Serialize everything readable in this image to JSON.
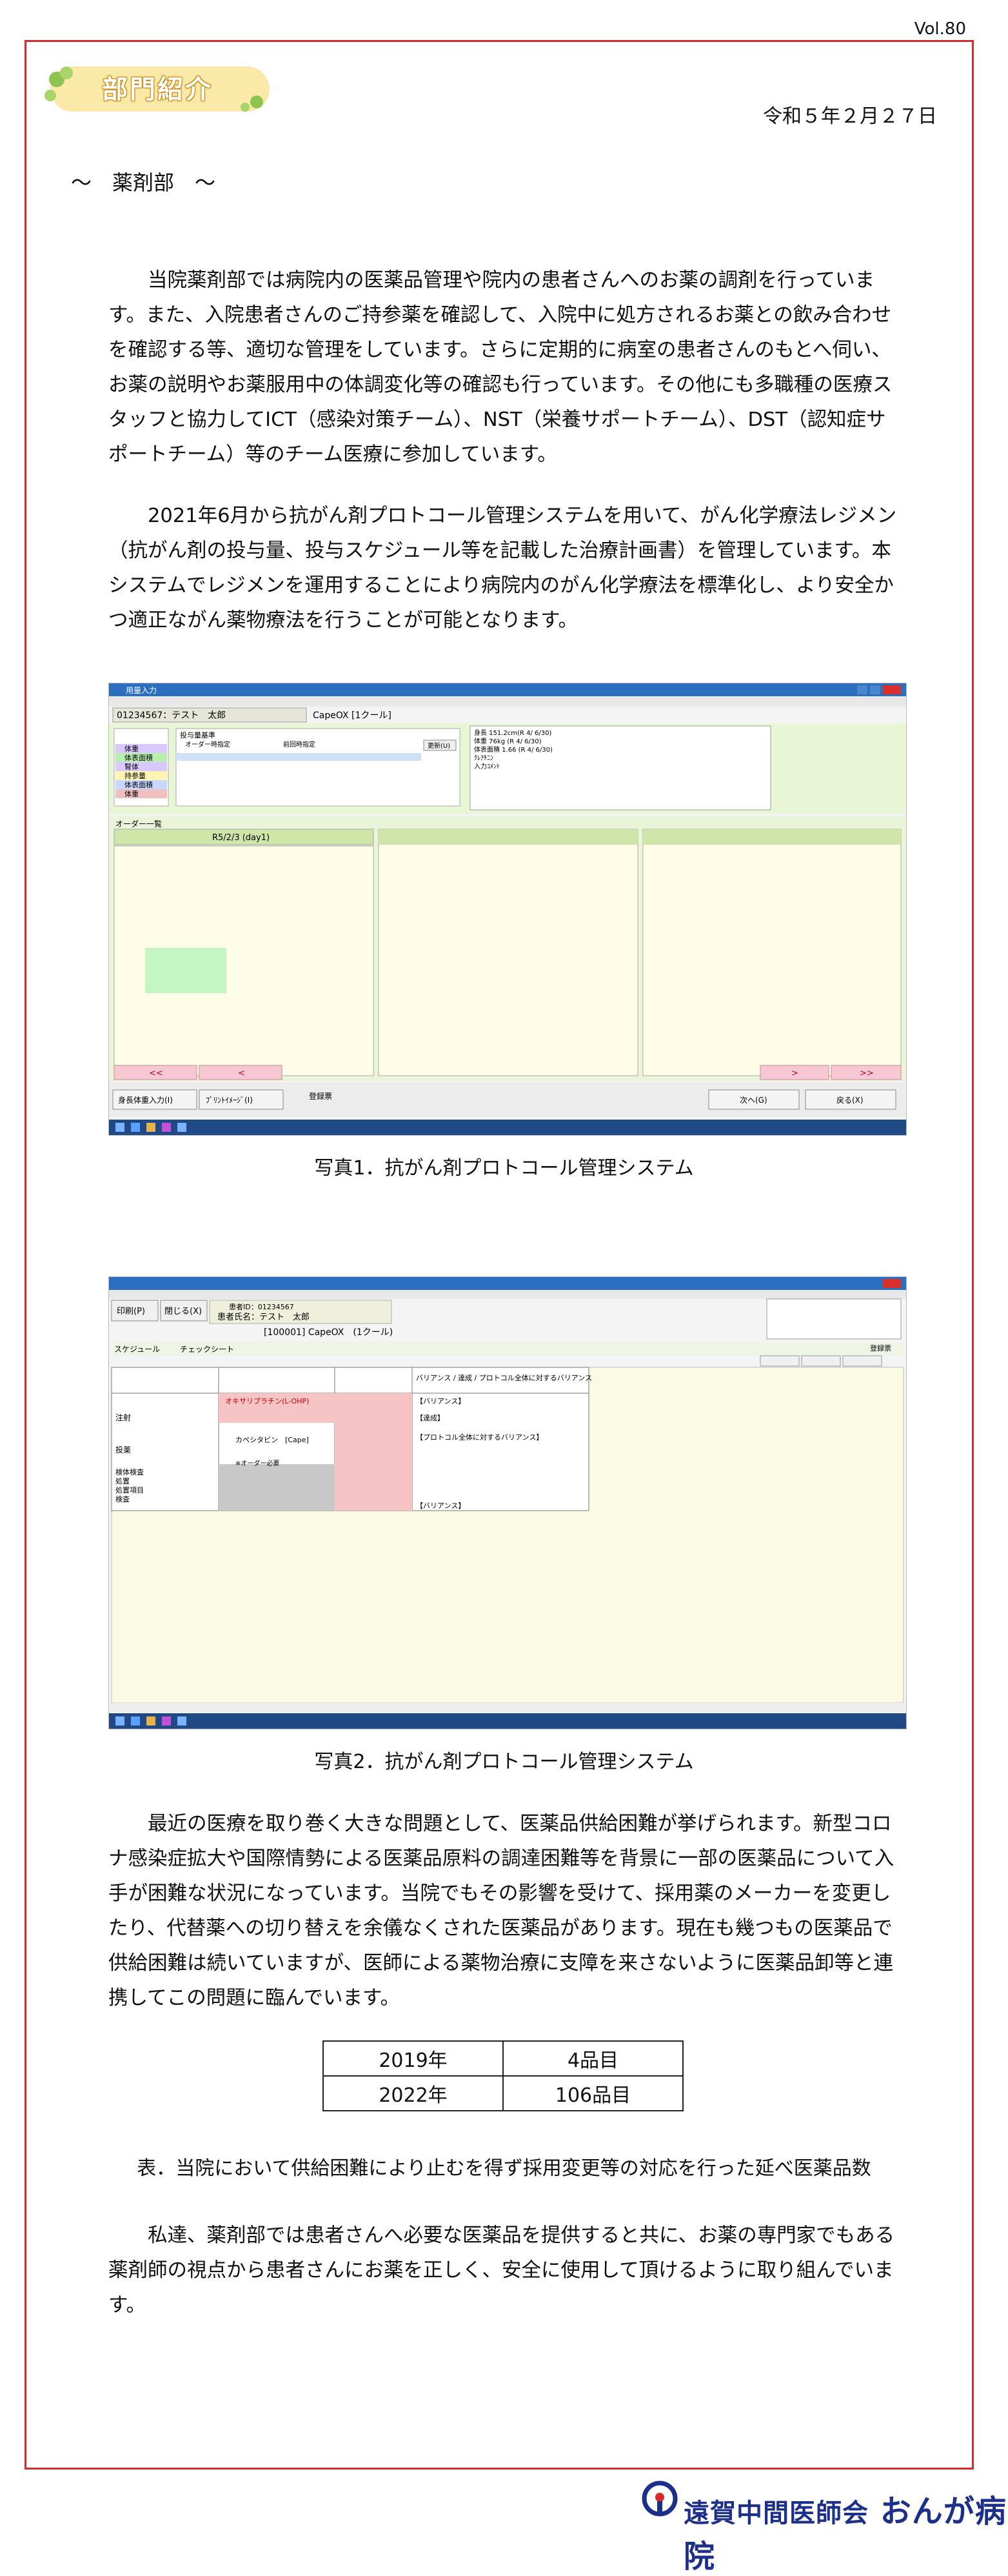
{
  "header": {
    "volume": "Vol.80",
    "section_badge": "部門紹介",
    "date": "令和５年２月２７日",
    "department_title": "～　薬剤部　～"
  },
  "body": {
    "para1": "当院薬剤部では病院内の医薬品管理や院内の患者さんへのお薬の調剤を行っています。また、入院患者さんのご持参薬を確認して、入院中に処方されるお薬との飲み合わせを確認する等、適切な管理をしています。さらに定期的に病室の患者さんのもとへ伺い、お薬の説明やお薬服用中の体調変化等の確認も行っています。その他にも多職種の医療スタッフと協力してICT（感染対策チーム）、NST（栄養サポートチーム）、DST（認知症サポートチーム）等のチーム医療に参加しています。",
    "para2": "2021年6月から抗がん剤プロトコール管理システムを用いて、がん化学療法レジメン（抗がん剤の投与量、投与スケジュール等を記載した治療計画書）を管理しています。本システムでレジメンを運用することにより病院内のがん化学療法を標準化し、より安全かつ適正ながん薬物療法を行うことが可能となります。",
    "para3": "最近の医療を取り巻く大きな問題として、医薬品供給困難が挙げられます。新型コロナ感染症拡大や国際情勢による医薬品原料の調達困難等を背景に一部の医薬品について入手が困難な状況になっています。当院でもその影響を受けて、採用薬のメーカーを変更したり、代替薬への切り替えを余儀なくされた医薬品があります。現在も幾つもの医薬品で供給困難は続いていますが、医師による薬物治療に支障を来さないように医薬品卸等と連携してこの問題に臨んでいます。",
    "para4": "私達、薬剤部では患者さんへ必要な医薬品を提供すると共に、お薬の専門家でもある薬剤師の視点から患者さんにお薬を正しく、安全に使用して頂けるように取り組んでいます。"
  },
  "photo1": {
    "caption": "写真1．抗がん剤プロトコール管理システム",
    "window_title": "用量入力",
    "patient": "01234567：テスト　太郎",
    "regimen": "CapeOX [1クール]",
    "order_list_title": "オーダー一覧",
    "day_label": "R5/2/3 (day1)",
    "left_items": [
      "体重",
      "体表面積",
      "腎体",
      "持参量",
      "体表面積",
      "体重"
    ],
    "basis_title": "投与量基準",
    "basis_option1": "オーダー時指定",
    "basis_option2": "前回時指定",
    "update_button": "更新(U)",
    "nav_prev_all": "<<",
    "nav_prev": "<",
    "nav_next": ">",
    "nav_next_all": ">>",
    "btn_dose_input": "身長体重入力(I)",
    "btn_print": "ﾌﾟﾘﾝﾄｲﾒｰｼﾞ(I)",
    "btn_register": "登録票",
    "btn_next": "次へ(G)",
    "btn_back": "戻る(X)",
    "vitals": [
      "身長 151.2cm(R 4/ 6/30)",
      "体重 76kg (R 4/ 6/30)",
      "体表面積 1.66 (R 4/ 6/30)",
      "ｸﾚｱﾁﾆﾝ",
      "入力ｺﾒﾝﾄ"
    ]
  },
  "photo2": {
    "caption": "写真2．抗がん剤プロトコール管理システム",
    "btn_print": "印刷(P)",
    "btn_close": "閉じる(X)",
    "patient_id": "患者ID：01234567",
    "patient_name": "患者氏名：テスト　太郎",
    "regimen": "[100001] CapeOX　(1クール)",
    "tab_schedule": "スケジュール",
    "tab_check": "チェックシート",
    "btn_register": "登録票",
    "rows": [
      "注射",
      "投薬",
      "検体検査",
      "処置",
      "処置項目",
      "検査"
    ],
    "drug1": "オキサリプラチン(L-OHP)",
    "drug2": "カペシタビン　[Cape]",
    "variance_title": "バリアンス / 達成 / プロトコル全体に対するバリアンス",
    "variance1": "【バリアンス】",
    "variance2": "【達成】",
    "variance3": "【プロトコル全体に対するバリアンス】",
    "order_note": "※オーダー必要"
  },
  "table": {
    "caption": "表．当院において供給困難により止むを得ず採用変更等の対応を行った延べ医薬品数",
    "rows": [
      {
        "year": "2019年",
        "count": "4品目"
      },
      {
        "year": "2022年",
        "count": "106品目"
      }
    ]
  },
  "footer": {
    "org": "遠賀中間医師会",
    "hospital": "おんが病院"
  },
  "colors": {
    "frame": "#d22e2e",
    "footer_brand": "#1c2f8a",
    "taskbar": "#1f4a86"
  }
}
